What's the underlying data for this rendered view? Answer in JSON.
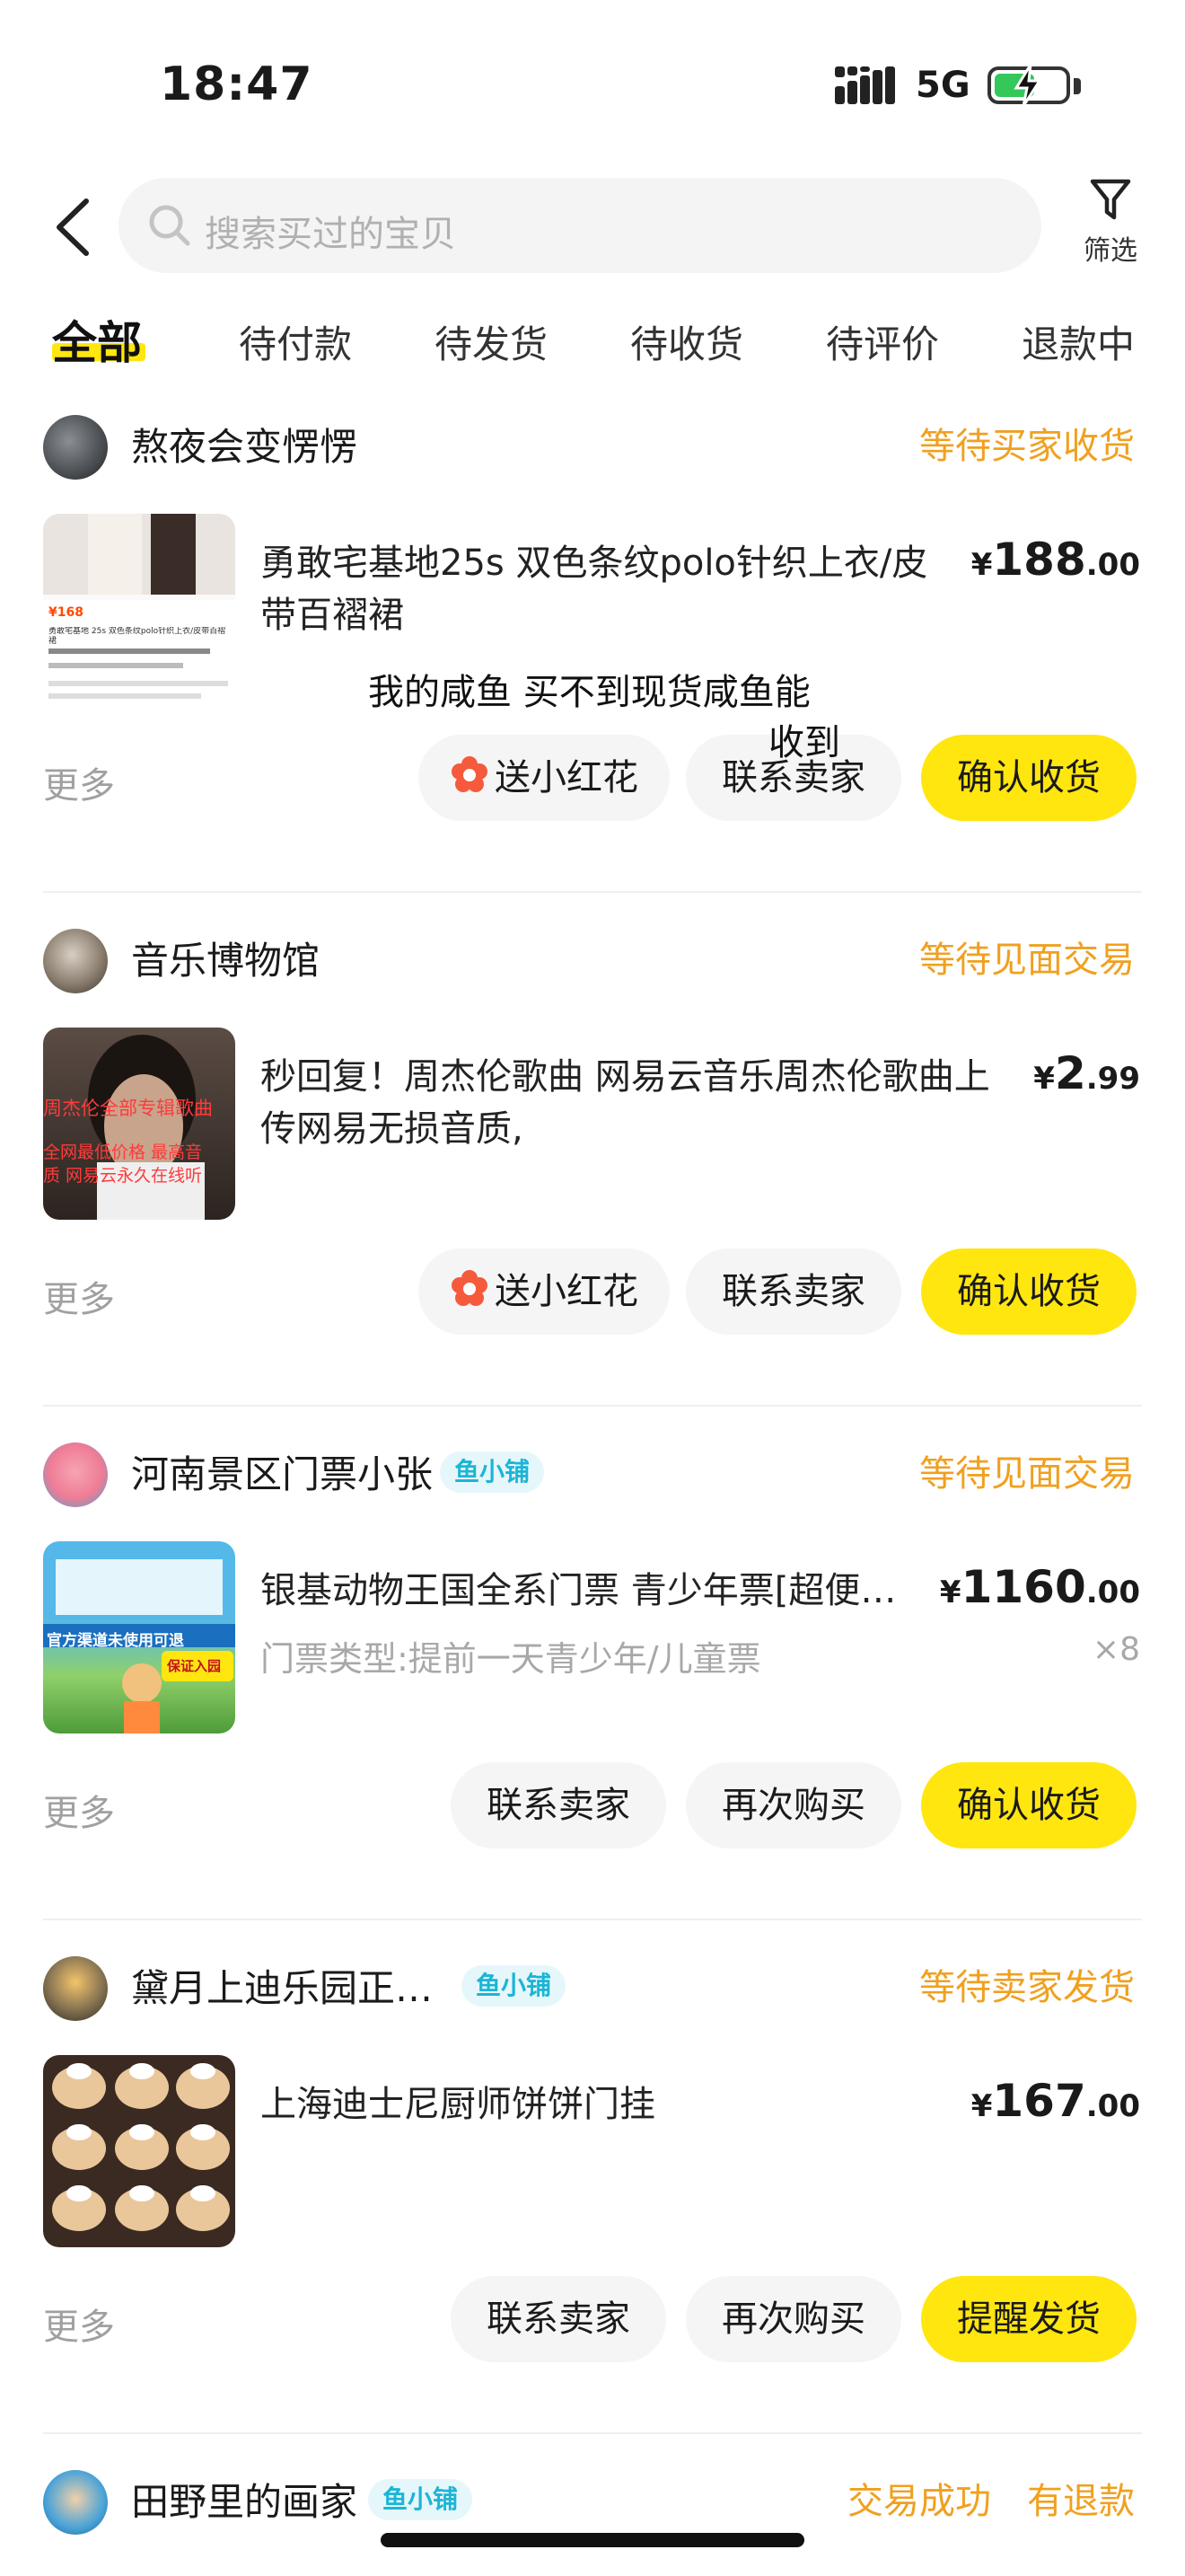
{
  "status_bar": {
    "time": "18:47",
    "network": "5G"
  },
  "search": {
    "placeholder": "搜索买过的宝贝"
  },
  "filter": {
    "label": "筛选"
  },
  "tabs": [
    "全部",
    "待付款",
    "待发货",
    "待收货",
    "待评价",
    "退款中"
  ],
  "orders": [
    {
      "seller": "熬夜会变愣愣",
      "status": "等待买家收货",
      "title": "勇敢宅基地25s 双色条纹polo针织上衣/皮带百褶裙",
      "price": {
        "currency": "¥",
        "integer": "188",
        "decimal": ".00"
      },
      "thumb_text": {
        "price": "¥168",
        "caption": "勇敢宅基地 25s 双色条纹polo针织上衣/皮带百褶裙"
      },
      "more": "更多",
      "buttons": [
        "送小红花",
        "联系卖家",
        "确认收货"
      ]
    },
    {
      "seller": "音乐博物馆",
      "status": "等待见面交易",
      "title": "秒回复！周杰伦歌曲 网易云音乐周杰伦歌曲上传网易无损音质,",
      "price": {
        "currency": "¥",
        "integer": "2",
        "decimal": ".99"
      },
      "thumb_text": {
        "line1": "周杰伦全部专辑歌曲",
        "line2": "全网最低价格 最高音",
        "line3": "质 网易云永久在线听"
      },
      "more": "更多",
      "buttons": [
        "送小红花",
        "联系卖家",
        "确认收货"
      ]
    },
    {
      "seller": "河南景区门票小张",
      "badge": "鱼小铺",
      "status": "等待见面交易",
      "title": "银基动物王国全系门票 青少年票[超便宜 可退",
      "subtitle": "门票类型:提前一天青少年/儿童票",
      "quantity": "×8",
      "price": {
        "currency": "¥",
        "integer": "1160",
        "decimal": ".00"
      },
      "thumb_text": {
        "banner": "官方渠道未使用可退",
        "stamp": "保证入园"
      },
      "more": "更多",
      "buttons": [
        "联系卖家",
        "再次购买",
        "确认收货"
      ]
    },
    {
      "seller": "黛月上迪乐园正品代购",
      "badge": "鱼小铺",
      "status": "等待卖家发货",
      "title": "上海迪士尼厨师饼饼门挂",
      "price": {
        "currency": "¥",
        "integer": "167",
        "decimal": ".00"
      },
      "more": "更多",
      "buttons": [
        "联系卖家",
        "再次购买",
        "提醒发货"
      ]
    },
    {
      "seller": "田野里的画家",
      "badge": "鱼小铺",
      "status": "交易成功",
      "status_extra": "有退款"
    }
  ],
  "overlay_note": {
    "line1": "我的咸鱼 买不到现货咸鱼能",
    "line2": "收到"
  },
  "colors": {
    "accent_yellow": "#ffe60f",
    "status_orange": "#f0a020",
    "badge_cyan": "#1cb5d6"
  }
}
